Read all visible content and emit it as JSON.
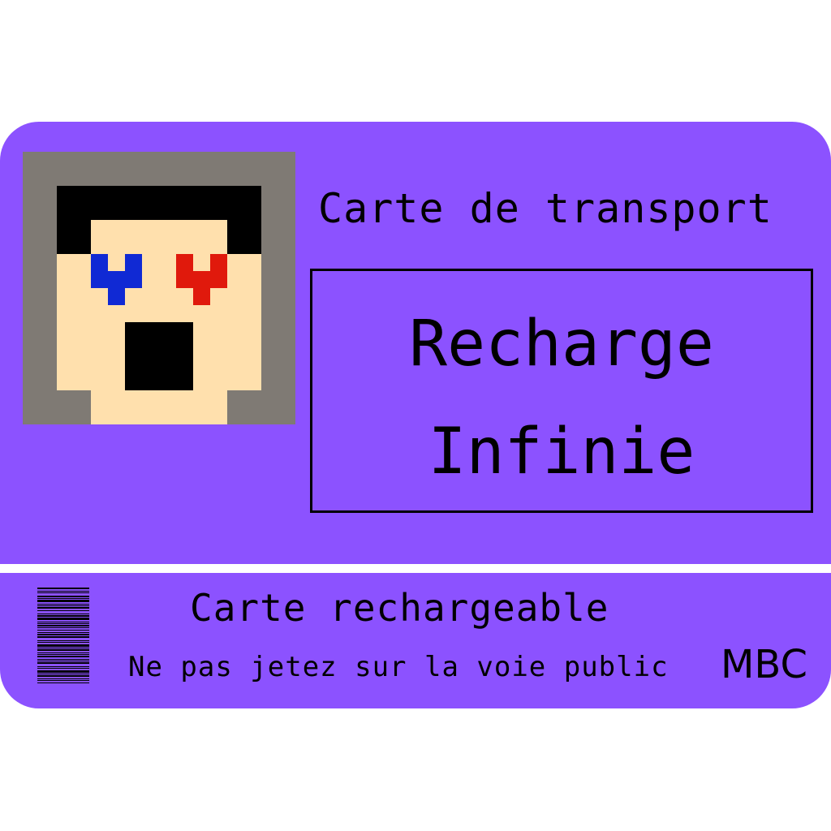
{
  "colors": {
    "card": "#8c52ff",
    "ink": "#000000",
    "photo_background": "#7f7a74",
    "skin": "#ffe0ad",
    "hair": "#000000",
    "left_eye": "#1029d4",
    "right_eye": "#e0190c",
    "mouth": "#000000"
  },
  "card": {
    "title": "Carte de transport",
    "photo_icon": "pixel-face-icon",
    "name_box": {
      "line1": "Recharge",
      "line2": "Infinie"
    }
  },
  "footer": {
    "barcode_icon": "barcode-icon",
    "subtitle": "Carte rechargeable",
    "notice": "Ne pas jetez sur la voie public",
    "brand": "MBC"
  }
}
